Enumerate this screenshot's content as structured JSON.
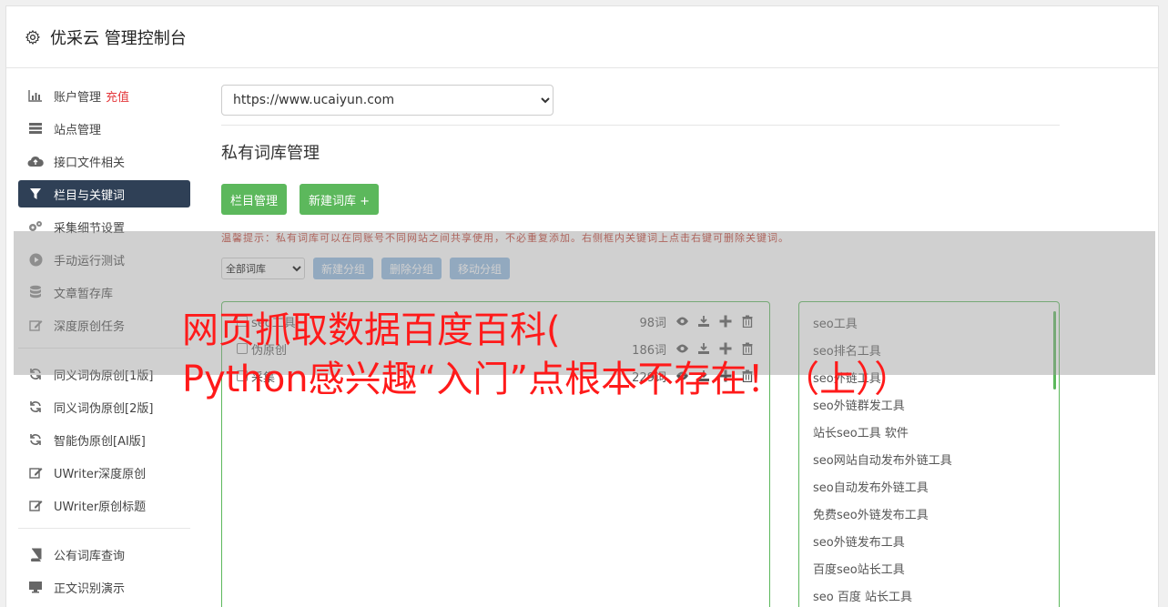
{
  "header": {
    "title": "优采云 管理控制台",
    "icon": "gear-icon"
  },
  "sidebar": {
    "group1": [
      {
        "label": "账户管理",
        "badge": "充值",
        "icon": "bar-chart-icon"
      },
      {
        "label": "站点管理",
        "icon": "server-icon"
      },
      {
        "label": "接口文件相关",
        "icon": "cloud-upload-icon"
      },
      {
        "label": "栏目与关键词",
        "icon": "filter-icon",
        "active": true
      },
      {
        "label": "采集细节设置",
        "icon": "gears-icon"
      },
      {
        "label": "手动运行测试",
        "icon": "play-circle-icon"
      },
      {
        "label": "文章暂存库",
        "icon": "database-icon"
      },
      {
        "label": "深度原创任务",
        "icon": "edit-icon"
      }
    ],
    "group2": [
      {
        "label": "同义词伪原创[1版]",
        "icon": "refresh-icon"
      },
      {
        "label": "同义词伪原创[2版]",
        "icon": "refresh-icon"
      },
      {
        "label": "智能伪原创[AI版]",
        "icon": "refresh-icon"
      },
      {
        "label": "UWriter深度原创",
        "icon": "edit-icon"
      },
      {
        "label": "UWriter原创标题",
        "icon": "edit-icon"
      }
    ],
    "group3": [
      {
        "label": "公有词库查询",
        "icon": "book-icon"
      },
      {
        "label": "正文识别演示",
        "icon": "monitor-icon"
      }
    ]
  },
  "main": {
    "site_select": "https://www.ucaiyun.com",
    "page_title": "私有词库管理",
    "buttons": {
      "column_manage": "栏目管理",
      "new_library": "新建词库 +"
    },
    "tip": "温馨提示：私有词库可以在同账号不同网站之间共享使用，不必重复添加。右侧框内关键词上点击右键可删除关键词。",
    "library_select": "全部词库",
    "group_buttons": {
      "new_group": "新建分组",
      "delete_group": "删除分组",
      "move_group": "移动分组"
    },
    "libraries": [
      {
        "name": "seo工具",
        "count": "98词"
      },
      {
        "name": "伪原创",
        "count": "186词"
      },
      {
        "name": "采集",
        "count": "229词"
      }
    ],
    "keywords": [
      "seo工具",
      "seo排名工具",
      "seo外链工具",
      "seo外链群发工具",
      "站长seo工具 软件",
      "seo网站自动发布外链工具",
      "seo自动发布外链工具",
      "免费seo外链发布工具",
      "seo外链发布工具",
      "百度seo站长工具",
      "seo 百度 站长工具"
    ]
  },
  "overlay": {
    "line1": "网页抓取数据百度百科(",
    "line2": "Python感兴趣“入门”点根本不存在！（上））"
  },
  "colors": {
    "accent_green": "#5cb85c",
    "nav_active": "#2f4056",
    "tip_red": "#c0392b",
    "overlay_red": "#ff1a1a",
    "group_blue": "#8fb8e0"
  }
}
